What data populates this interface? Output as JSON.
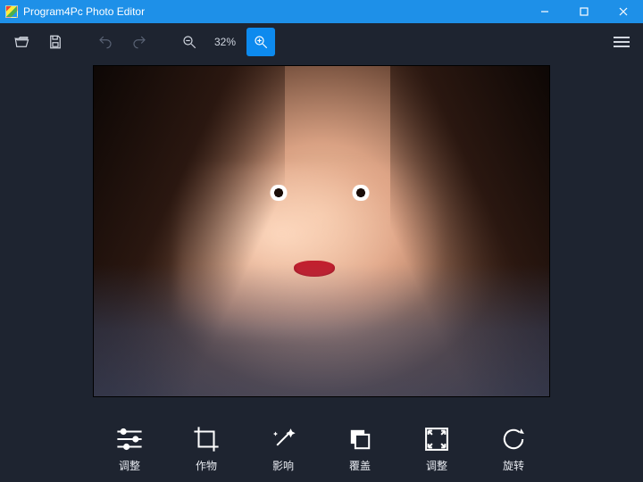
{
  "titlebar": {
    "title": "Program4Pc Photo Editor"
  },
  "toolbar": {
    "zoom_text": "32%"
  },
  "bottom": {
    "tool0": "调整",
    "tool1": "作物",
    "tool2": "影响",
    "tool3": "覆盖",
    "tool4": "调整",
    "tool5": "旋转"
  }
}
